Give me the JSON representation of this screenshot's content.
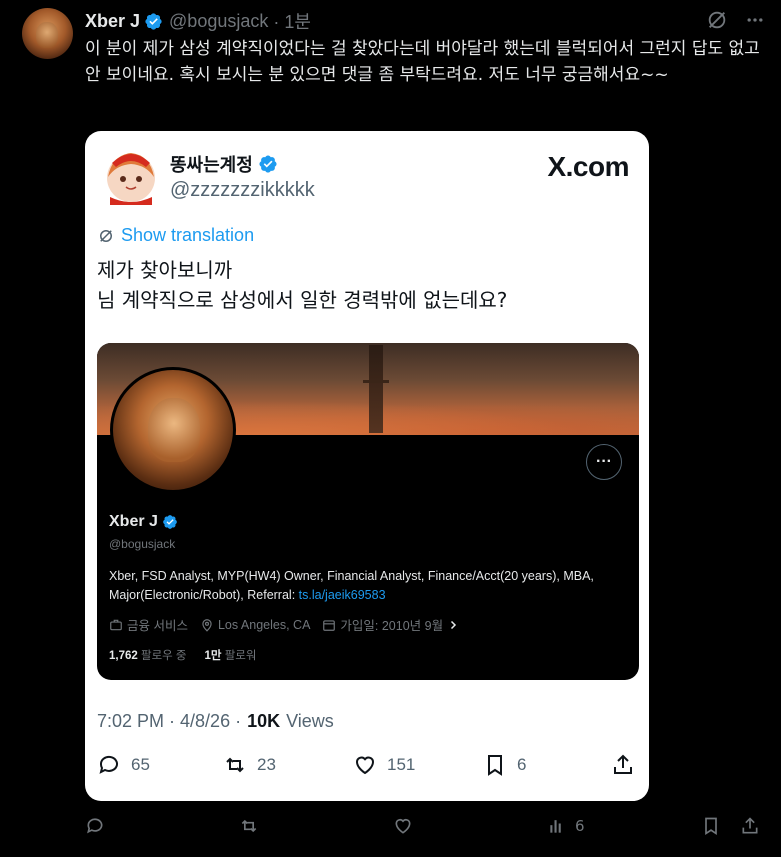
{
  "tweet": {
    "author_name": "Xber J",
    "author_handle": "@bogusjack",
    "time_ago": "· 1분",
    "text": "이 분이 제가 삼성 계약직이었다는 걸 찾았다는데 버야달라 했는데 블럭되어서 그런지 답도 없고 안 보이네요. 혹시 보시는 분 있으면 댓글 좀 부탁드려요. 저도 너무 궁금해서요~~",
    "views_count": "6"
  },
  "card": {
    "name": "똥싸는계정",
    "handle": "@zzzzzzzikkkkk",
    "brand": "X.com",
    "translate_label": "Show translation",
    "text_line1": "제가 찾아보니까",
    "text_line2": "님 계약직으로 삼성에서 일한 경력밖에 없는데요?",
    "time": "7:02 PM · 4/8/26 ·",
    "views_value": "10K",
    "views_label": "Views",
    "replies": "65",
    "reposts": "23",
    "likes": "151",
    "bookmarks": "6"
  },
  "profile": {
    "name": "Xber J",
    "handle": "@bogusjack",
    "more_label": "···",
    "bio_text": "Xber, FSD Analyst, MYP(HW4) Owner, Financial Analyst, Finance/Acct(20 years), MBA, Major(Electronic/Robot), Referral: ",
    "bio_link": "ts.la/jaeik69583",
    "category": "금융 서비스",
    "location": "Los Angeles, CA",
    "joined": "가입일: 2010년 9월",
    "followers_count": "1,762",
    "followers_label": "팔로우 중",
    "following_count": "1만",
    "following_label": "팔로워"
  },
  "colors": {
    "background": "#000000",
    "accent": "#1d9bf0",
    "muted": "#71767b"
  }
}
